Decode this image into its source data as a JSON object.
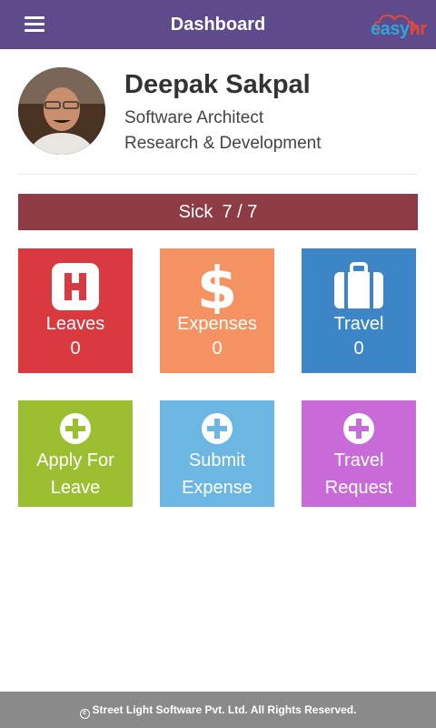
{
  "header": {
    "title": "Dashboard",
    "menu_icon": "hamburger-menu-icon",
    "brand_text_a": "easy",
    "brand_text_b": "hr",
    "brand_color": "#2aa6d8"
  },
  "profile": {
    "name": "Deepak Sakpal",
    "role": "Software Architect",
    "department": "Research & Development"
  },
  "leave_summary": {
    "type": "Sick",
    "value": "7 / 7",
    "color": "#8d3c46"
  },
  "stats": [
    {
      "label": "Leaves",
      "value": "0",
      "icon": "hospital-icon",
      "color": "#d9393f"
    },
    {
      "label": "Expenses",
      "value": "0",
      "icon": "dollar-icon",
      "color": "#f49261"
    },
    {
      "label": "Travel",
      "value": "0",
      "icon": "suitcase-icon",
      "color": "#3c85c7"
    }
  ],
  "actions": [
    {
      "line1": "Apply For",
      "line2": "Leave",
      "icon": "plus-circle-icon",
      "color": "#9bbf31"
    },
    {
      "line1": "Submit",
      "line2": "Expense",
      "icon": "plus-circle-icon",
      "color": "#6bb6e3"
    },
    {
      "line1": "Travel",
      "line2": "Request",
      "icon": "plus-circle-icon",
      "color": "#c86ad7"
    }
  ],
  "footer": {
    "text": "Street Light Software Pvt. Ltd. All Rights Reserved."
  }
}
